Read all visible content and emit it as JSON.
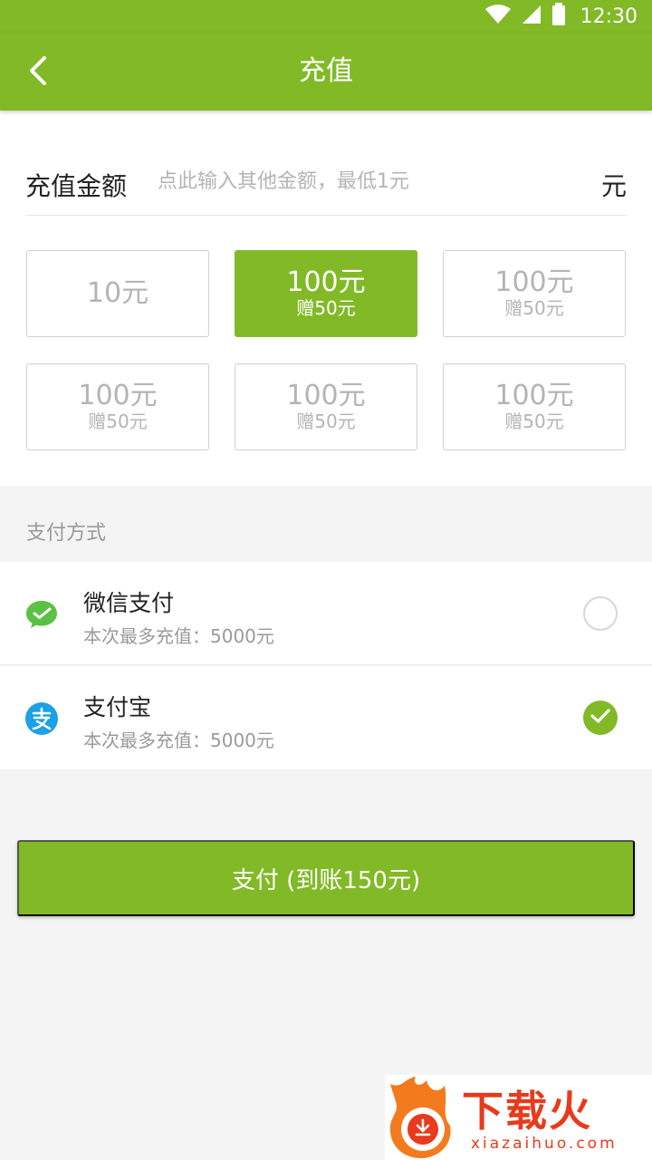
{
  "status_bar": {
    "time": "12:30",
    "icons": [
      "wifi-icon",
      "signal-icon",
      "battery-icon"
    ]
  },
  "app_bar": {
    "title": "充值",
    "back_icon": "chevron-left-icon"
  },
  "amount": {
    "label": "充值金额",
    "placeholder": "点此输入其他金额，最低1元",
    "unit": "元",
    "options": [
      {
        "main": "10元",
        "sub": "",
        "selected": false
      },
      {
        "main": "100元",
        "sub": "赠50元",
        "selected": true
      },
      {
        "main": "100元",
        "sub": "赠50元",
        "selected": false
      },
      {
        "main": "100元",
        "sub": "赠50元",
        "selected": false
      },
      {
        "main": "100元",
        "sub": "赠50元",
        "selected": false
      },
      {
        "main": "100元",
        "sub": "赠50元",
        "selected": false
      }
    ]
  },
  "payment": {
    "section_label": "支付方式",
    "methods": [
      {
        "name": "微信支付",
        "limit": "本次最多充值：5000元",
        "icon": "wechat-pay-icon",
        "checked": false
      },
      {
        "name": "支付宝",
        "limit": "本次最多充值：5000元",
        "icon": "alipay-icon",
        "checked": true
      }
    ]
  },
  "pay_button": {
    "label": "支付 (到账150元)"
  },
  "watermark": {
    "brand": "下载火",
    "url": "xiazaihuo.com"
  },
  "colors": {
    "primary": "#82b927",
    "alipay": "#1da1e6",
    "wechat": "#5ac145",
    "watermark": "#e83a1c"
  }
}
